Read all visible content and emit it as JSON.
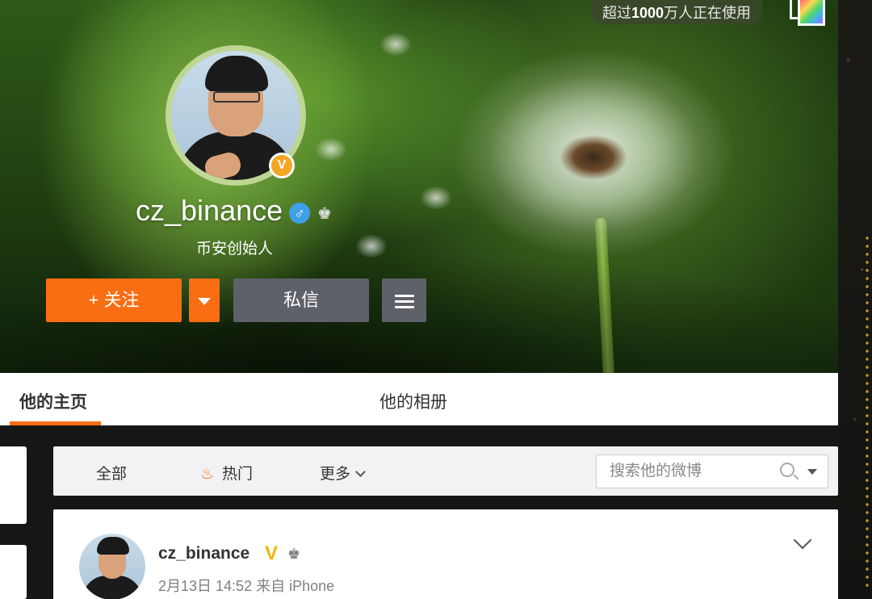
{
  "cover": {
    "usage_prefix": "超过",
    "usage_bold": "1000",
    "usage_suffix": "万人正在使用"
  },
  "profile": {
    "username": "cz_binance",
    "gender_symbol": "♂",
    "crown_symbol": "♚",
    "verified_badge": "V",
    "bio": "币安创始人"
  },
  "actions": {
    "follow_label": "+ 关注",
    "message_label": "私信"
  },
  "tabs": [
    {
      "label": "他的主页",
      "active": true
    },
    {
      "label": "他的相册",
      "active": false
    }
  ],
  "filter": {
    "items": [
      "全部",
      "热门",
      "更多"
    ],
    "search_placeholder": "搜索他的微博"
  },
  "post": {
    "author": "cz_binance",
    "verified_mark": "V",
    "crown_symbol": "♚",
    "meta": "2月13日 14:52 来自 iPhone"
  },
  "colors": {
    "accent": "#f96d13",
    "secondary_button": "#5f6168",
    "verified_gold": "#f5b400",
    "gender_blue": "#3ea0e6"
  }
}
